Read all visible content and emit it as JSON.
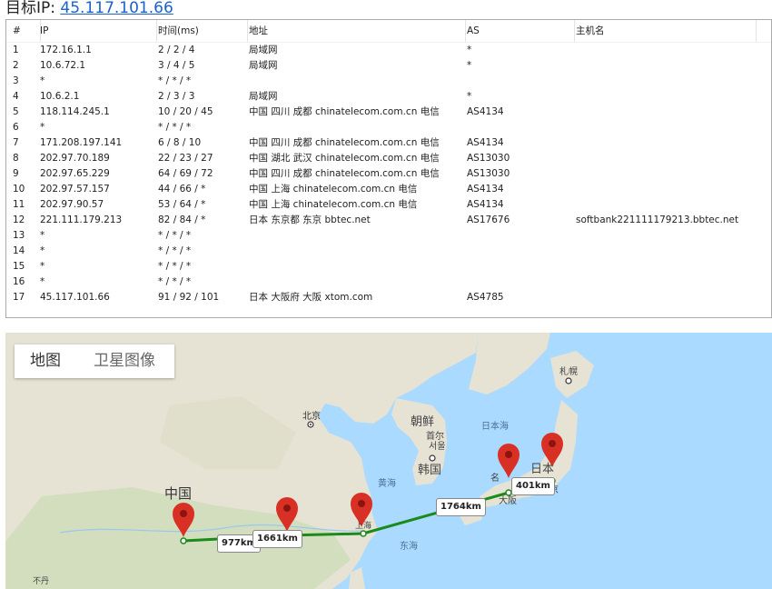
{
  "header": {
    "label": "目标IP:",
    "ip": "45.117.101.66"
  },
  "table": {
    "columns": [
      "#",
      "IP",
      "时间(ms)",
      "地址",
      "AS",
      "主机名"
    ],
    "rows": [
      [
        "1",
        "172.16.1.1",
        "2 / 2 / 4",
        "局域网",
        "*",
        ""
      ],
      [
        "2",
        "10.6.72.1",
        "3 / 4 / 5",
        "局域网",
        "*",
        ""
      ],
      [
        "3",
        "*",
        "* / * / *",
        "",
        "",
        ""
      ],
      [
        "4",
        "10.6.2.1",
        "2 / 3 / 3",
        "局域网",
        "*",
        ""
      ],
      [
        "5",
        "118.114.245.1",
        "10 / 20 / 45",
        "中国 四川 成都 chinatelecom.com.cn 电信",
        "AS4134",
        ""
      ],
      [
        "6",
        "*",
        "* / * / *",
        "",
        "",
        ""
      ],
      [
        "7",
        "171.208.197.141",
        "6 / 8 / 10",
        "中国 四川 成都 chinatelecom.com.cn 电信",
        "AS4134",
        ""
      ],
      [
        "8",
        "202.97.70.189",
        "22 / 23 / 27",
        "中国 湖北 武汉 chinatelecom.com.cn 电信",
        "AS13030",
        ""
      ],
      [
        "9",
        "202.97.65.229",
        "64 / 69 / 72",
        "中国 四川 成都 chinatelecom.com.cn 电信",
        "AS13030",
        ""
      ],
      [
        "10",
        "202.97.57.157",
        "44 / 66 / *",
        "中国 上海 chinatelecom.com.cn 电信",
        "AS4134",
        ""
      ],
      [
        "11",
        "202.97.90.57",
        "53 / 64 / *",
        "中国 上海 chinatelecom.com.cn 电信",
        "AS4134",
        ""
      ],
      [
        "12",
        "221.111.179.213",
        "82 / 84 / *",
        "日本 东京都 东京 bbtec.net",
        "AS17676",
        "softbank221111179213.bbtec.net"
      ],
      [
        "13",
        "*",
        "* / * / *",
        "",
        "",
        ""
      ],
      [
        "14",
        "*",
        "* / * / *",
        "",
        "",
        ""
      ],
      [
        "15",
        "*",
        "* / * / *",
        "",
        "",
        ""
      ],
      [
        "16",
        "*",
        "* / * / *",
        "",
        "",
        ""
      ],
      [
        "17",
        "45.117.101.66",
        "91 / 92 / 101",
        "日本 大阪府 大阪 xtom.com",
        "AS4785",
        ""
      ]
    ]
  },
  "map": {
    "tabs": {
      "map": "地图",
      "satellite": "卫星图像"
    },
    "labels": {
      "beijing": "北京",
      "korea_n": "朝鲜",
      "seoul_cn": "首尔",
      "seoul_kr": "서울",
      "korea": "韩国",
      "sea_japan": "日本海",
      "yellow_sea": "黄海",
      "east_sea": "东海",
      "china": "中国",
      "sapporo": "札幌",
      "japan_partial": "日本",
      "nagoya_partial": "名",
      "osaka": "大阪",
      "tokyo_partial": "京",
      "shanghai_partial": "上海",
      "bhutan_partial": "不丹"
    },
    "distances": [
      "977km",
      "1661km",
      "1764km",
      "401km"
    ],
    "colors": {
      "water": "#aadaff",
      "land": "#e6e3d5",
      "route": "#1a8a1a",
      "marker": "#d93025"
    }
  }
}
